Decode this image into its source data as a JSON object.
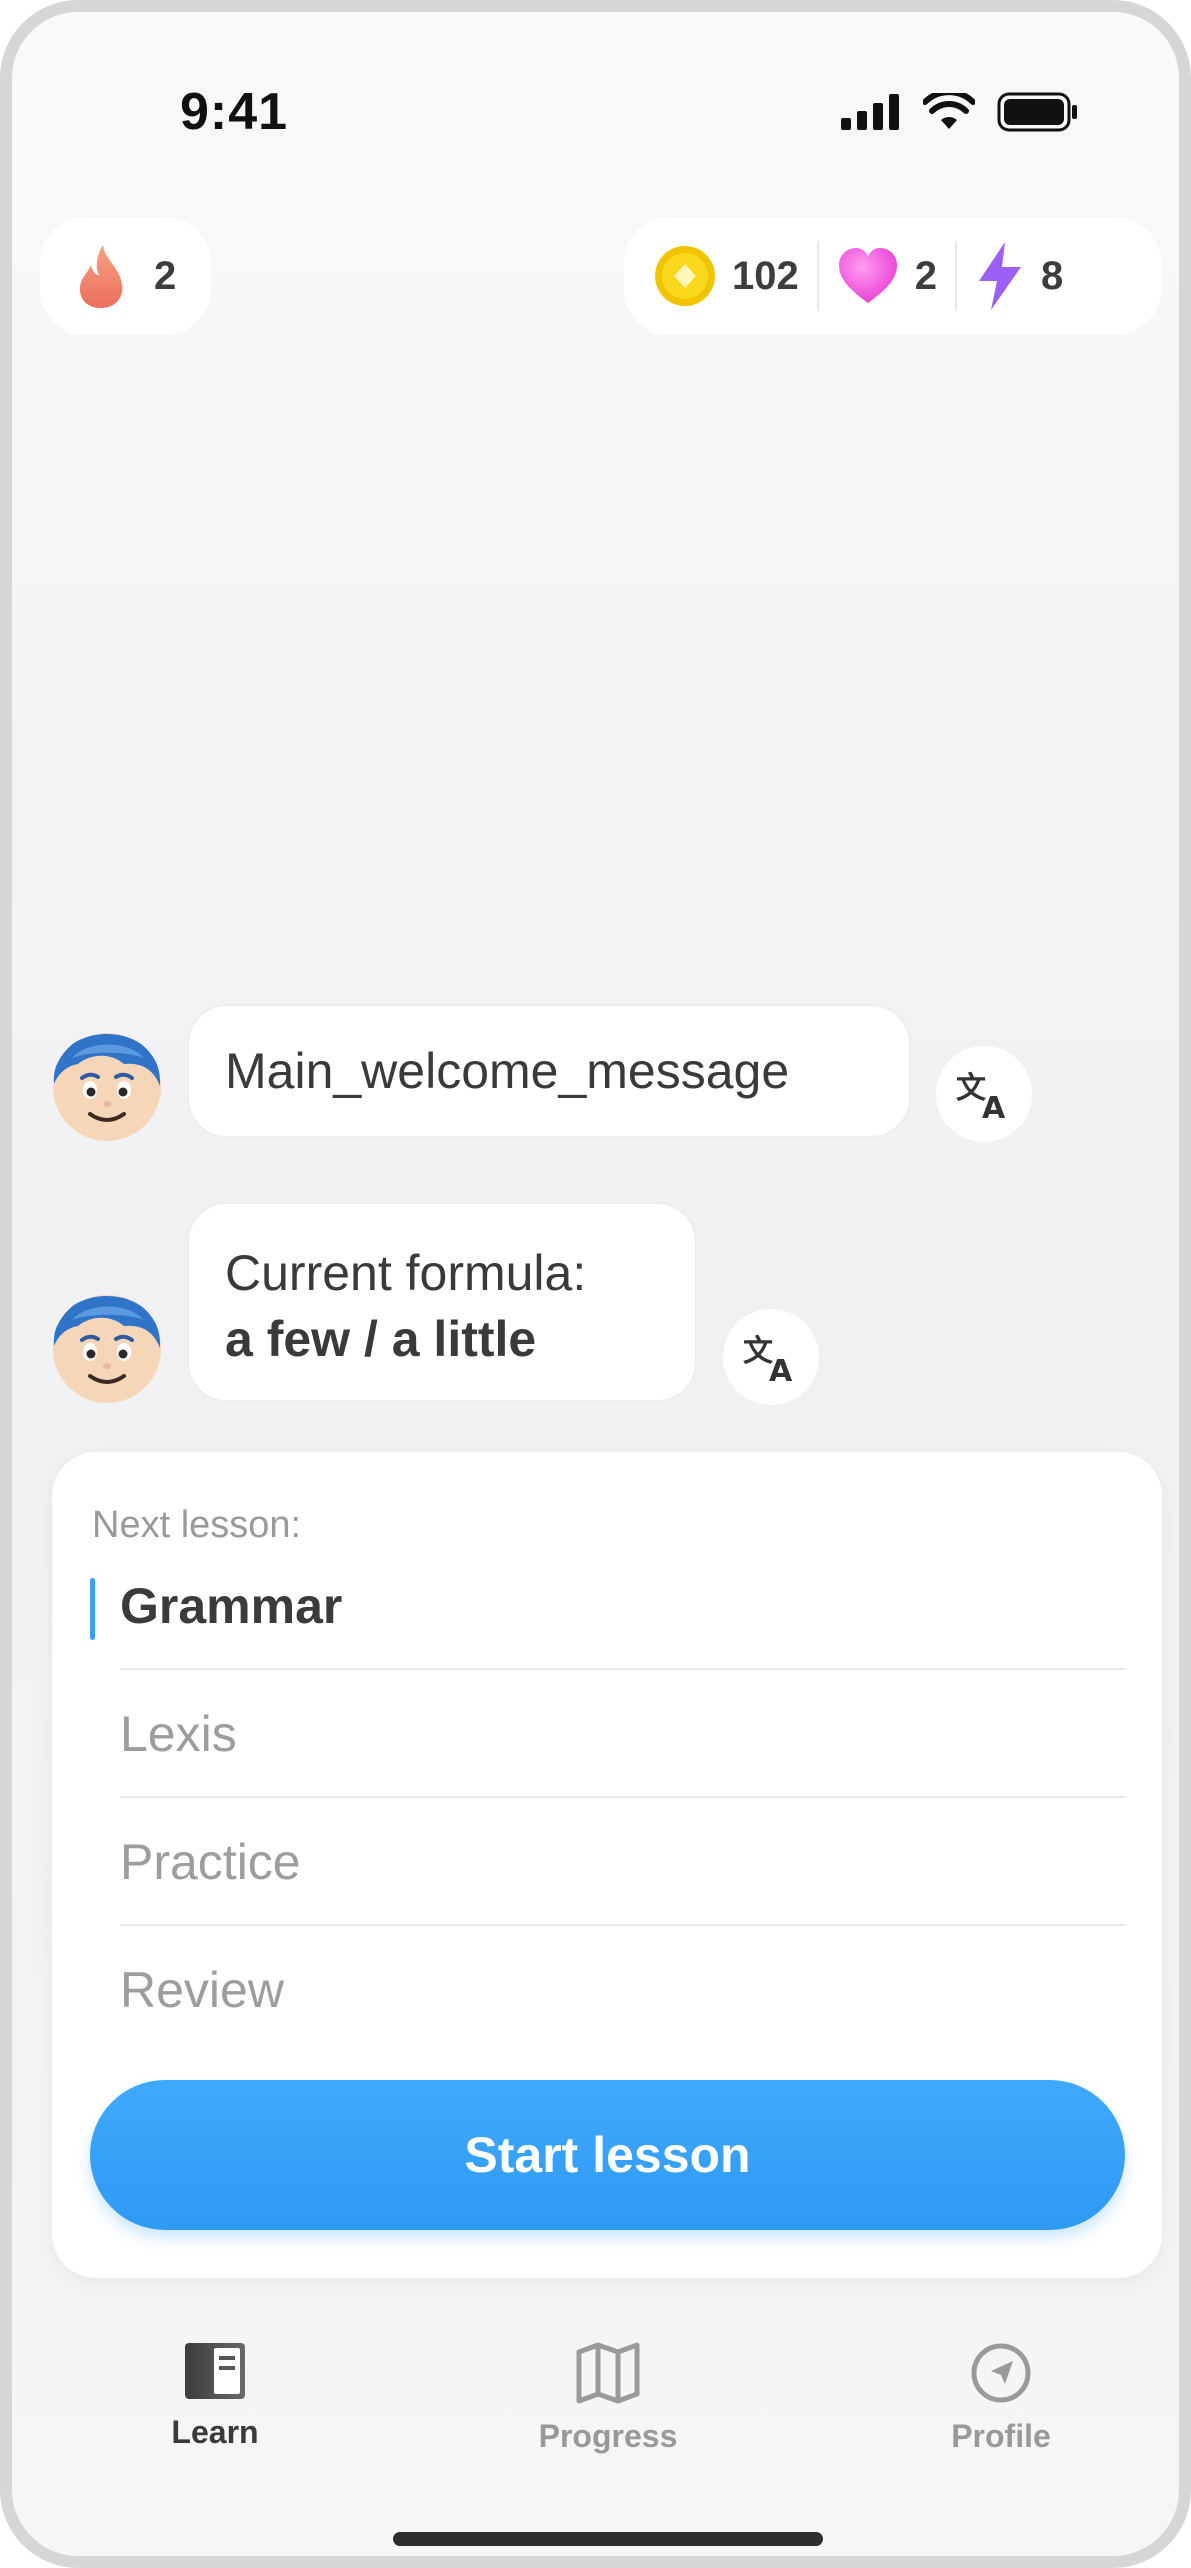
{
  "status_bar": {
    "time": "9:41",
    "icons": [
      "cellular-signal-icon",
      "wifi-icon",
      "battery-icon"
    ]
  },
  "header": {
    "streak": {
      "icon": "flame-icon",
      "value": "2"
    },
    "coins": {
      "icon": "coin-icon",
      "value": "102"
    },
    "hearts": {
      "icon": "heart-icon",
      "value": "2"
    },
    "energy": {
      "icon": "lightning-icon",
      "value": "8"
    }
  },
  "chat": {
    "messages": [
      {
        "text": "Main_welcome_message"
      },
      {
        "line1": "Current formula:",
        "line2": "a few / a little"
      }
    ],
    "translate_icon": "translate-icon"
  },
  "lesson_card": {
    "next_label": "Next lesson:",
    "items": [
      {
        "label": "Grammar",
        "active": true
      },
      {
        "label": "Lexis",
        "active": false
      },
      {
        "label": "Practice",
        "active": false
      },
      {
        "label": "Review",
        "active": false
      }
    ],
    "start_button": "Start lesson"
  },
  "tab_bar": {
    "tabs": [
      {
        "label": "Learn",
        "icon": "book-icon",
        "active": true
      },
      {
        "label": "Progress",
        "icon": "map-icon",
        "active": false
      },
      {
        "label": "Profile",
        "icon": "compass-icon",
        "active": false
      }
    ]
  },
  "colors": {
    "accent": "#3aa0f5",
    "coin": "#f5c800",
    "heart": "#f04ae0",
    "energy": "#9b5cf5",
    "flame": "#f3826a"
  }
}
